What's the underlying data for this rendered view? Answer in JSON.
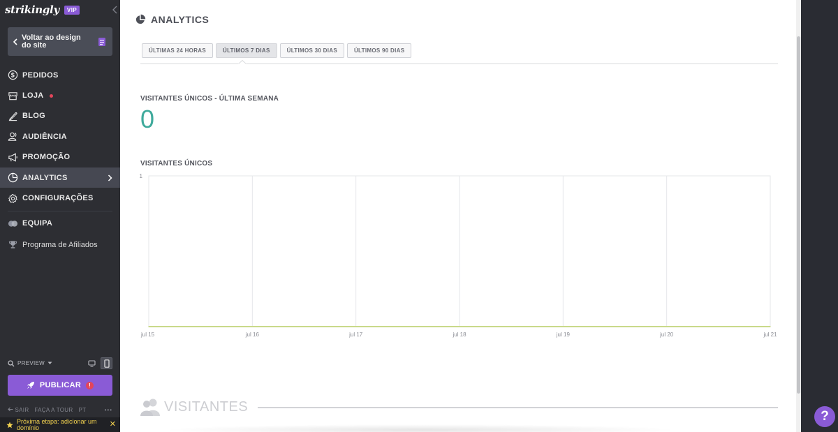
{
  "brand": {
    "logo": "strikingly",
    "badge": "VIP"
  },
  "sidebar": {
    "back_button": "Voltar ao design do site",
    "nav": [
      {
        "label": "PEDIDOS",
        "icon": "dollar-circle-icon"
      },
      {
        "label": "LOJA",
        "icon": "store-icon",
        "notification_dot": true
      },
      {
        "label": "BLOG",
        "icon": "pen-icon"
      },
      {
        "label": "AUDIÊNCIA",
        "icon": "users-icon"
      },
      {
        "label": "PROMOÇÃO",
        "icon": "megaphone-icon"
      },
      {
        "label": "ANALYTICS",
        "icon": "pie-chart-icon",
        "active": true
      },
      {
        "label": "CONFIGURAÇÕES",
        "icon": "gear-icon"
      },
      {
        "label": "EQUIPA",
        "icon": "team-icon"
      },
      {
        "label": "Programa de Afiliados",
        "icon": "trophy-icon"
      }
    ],
    "preview": {
      "label": "PREVIEW"
    },
    "publish": {
      "label": "PUBLICAR",
      "alert": "!"
    },
    "footer": {
      "exit": "SAIR",
      "tour": "FAÇA A TOUR",
      "language": "PT",
      "more": "•••"
    },
    "next_step": {
      "text": "Próxima etapa: adicionar um domínio",
      "close": "✕"
    }
  },
  "main": {
    "title": "ANALYTICS",
    "tabs": [
      {
        "label": "ÚLTIMAS 24 HORAS",
        "active": false
      },
      {
        "label": "ÚLTIMOS 7 DIAS",
        "active": true
      },
      {
        "label": "ÚLTIMOS 30 DIAS",
        "active": false
      },
      {
        "label": "ÚLTIMOS 90 DIAS",
        "active": false
      }
    ],
    "unique_visitors_week": {
      "label": "VISITANTES ÚNICOS - ÚLTIMA SEMANA",
      "value": "0"
    },
    "unique_visitors_chart_label": "VISITANTES ÚNICOS",
    "visitors_section": "VISITANTES"
  },
  "help_button": "?",
  "colors": {
    "accent": "#8a5bd6",
    "metric": "#3faa9c",
    "alert": "#e3455a",
    "line": "#c9d98a"
  },
  "chart_data": {
    "type": "line",
    "title": "",
    "xlabel": "",
    "ylabel": "",
    "categories": [
      "jul 15",
      "jul 16",
      "jul 17",
      "jul 18",
      "jul 19",
      "jul 20",
      "jul 21"
    ],
    "y_ticks": [
      "1"
    ],
    "ylim": [
      0,
      1
    ],
    "grid": true,
    "series": [
      {
        "values": [
          0,
          0,
          0,
          0,
          0,
          0,
          0
        ]
      }
    ]
  }
}
